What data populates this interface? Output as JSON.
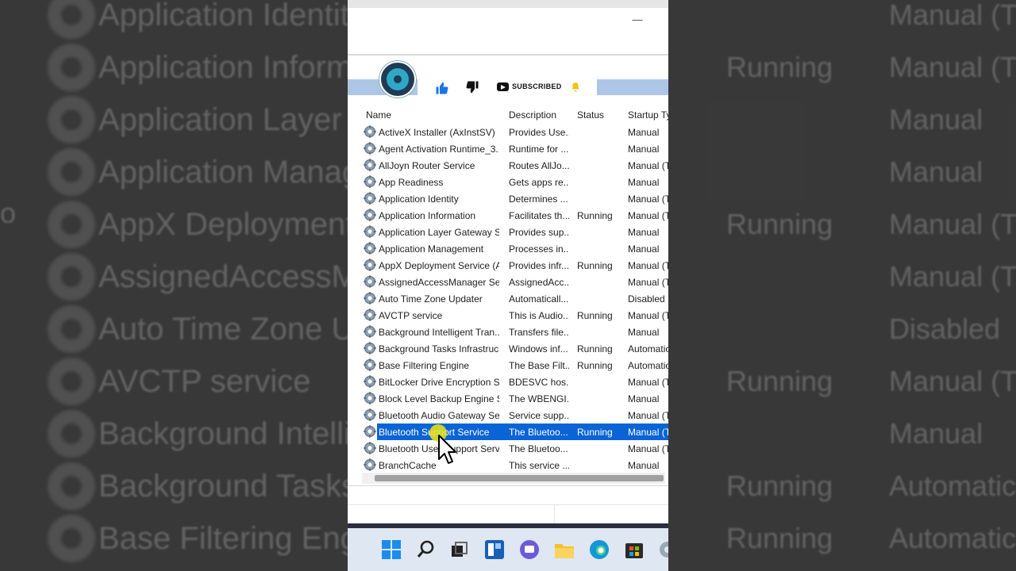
{
  "background": {
    "rows": [
      {
        "name": "Application Identity",
        "status": "",
        "startup": "Manual (T"
      },
      {
        "name": "Application Informa",
        "status": "Running",
        "startup": "Manual (T"
      },
      {
        "name": "Application Layer G",
        "status": "",
        "startup": "Manual"
      },
      {
        "name": "Application Manag",
        "status": "",
        "startup": "Manual"
      },
      {
        "name": "AppX Deployment S",
        "status": "Running",
        "startup": "Manual (T"
      },
      {
        "name": "AssignedAccessMar",
        "status": "",
        "startup": "Manual (T"
      },
      {
        "name": "Auto Time Zone Up",
        "status": "",
        "startup": "Disabled"
      },
      {
        "name": "AVCTP service",
        "status": "Running",
        "startup": "Manual (T"
      },
      {
        "name": "Background Intellig",
        "status": "",
        "startup": "Manual"
      },
      {
        "name": "Background Tasks I",
        "status": "Running",
        "startup": "Automatic"
      },
      {
        "name": "Base Filtering Engin",
        "status": "Running",
        "startup": "Automatic"
      }
    ],
    "stray_text": "o"
  },
  "window": {
    "minimize_glyph": "—"
  },
  "overlay": {
    "subscribed_label": "SUBSCRIBED"
  },
  "table": {
    "headers": {
      "name": "Name",
      "description": "Description",
      "status": "Status",
      "startup": "Startup Ty"
    },
    "selected_index": 18,
    "rows": [
      {
        "name": "ActiveX Installer (AxInstSV)",
        "description": "Provides Use...",
        "status": "",
        "startup": "Manual"
      },
      {
        "name": "Agent Activation Runtime_3...",
        "description": "Runtime for ...",
        "status": "",
        "startup": "Manual"
      },
      {
        "name": "AllJoyn Router Service",
        "description": "Routes AllJo...",
        "status": "",
        "startup": "Manual (T"
      },
      {
        "name": "App Readiness",
        "description": "Gets apps re...",
        "status": "",
        "startup": "Manual"
      },
      {
        "name": "Application Identity",
        "description": "Determines ...",
        "status": "",
        "startup": "Manual (T"
      },
      {
        "name": "Application Information",
        "description": "Facilitates th...",
        "status": "Running",
        "startup": "Manual (T"
      },
      {
        "name": "Application Layer Gateway S...",
        "description": "Provides sup...",
        "status": "",
        "startup": "Manual"
      },
      {
        "name": "Application Management",
        "description": "Processes in...",
        "status": "",
        "startup": "Manual"
      },
      {
        "name": "AppX Deployment Service (A...",
        "description": "Provides infr...",
        "status": "Running",
        "startup": "Manual (T"
      },
      {
        "name": "AssignedAccessManager Ser...",
        "description": "AssignedAcc...",
        "status": "",
        "startup": "Manual (T"
      },
      {
        "name": "Auto Time Zone Updater",
        "description": "Automaticall...",
        "status": "",
        "startup": "Disabled"
      },
      {
        "name": "AVCTP service",
        "description": "This is Audio...",
        "status": "Running",
        "startup": "Manual (T"
      },
      {
        "name": "Background Intelligent Tran...",
        "description": "Transfers file...",
        "status": "",
        "startup": "Manual"
      },
      {
        "name": "Background Tasks Infrastruc...",
        "description": "Windows inf...",
        "status": "Running",
        "startup": "Automatic"
      },
      {
        "name": "Base Filtering Engine",
        "description": "The Base Filt...",
        "status": "Running",
        "startup": "Automatic"
      },
      {
        "name": "BitLocker Drive Encryption S...",
        "description": "BDESVC hos...",
        "status": "",
        "startup": "Manual (T"
      },
      {
        "name": "Block Level Backup Engine S...",
        "description": "The WBENGI...",
        "status": "",
        "startup": "Manual"
      },
      {
        "name": "Bluetooth Audio Gateway Se...",
        "description": "Service supp...",
        "status": "",
        "startup": "Manual (T"
      },
      {
        "name": "Bluetooth Support Service",
        "description": "The Bluetoo...",
        "status": "Running",
        "startup": "Manual (T"
      },
      {
        "name": "Bluetooth User Support Serv...",
        "description": "The Bluetoo...",
        "status": "",
        "startup": "Manual (T"
      },
      {
        "name": "BranchCache",
        "description": "This service ...",
        "status": "",
        "startup": "Manual"
      }
    ]
  },
  "taskbar": {
    "icons": [
      "windows-start-icon",
      "search-icon",
      "task-view-icon",
      "widgets-icon",
      "teams-chat-icon",
      "file-explorer-icon",
      "edge-browser-icon",
      "microsoft-store-icon",
      "services-icon"
    ]
  },
  "colors": {
    "selection": "#0a64d6",
    "taskbar": "#dfe7f2"
  }
}
